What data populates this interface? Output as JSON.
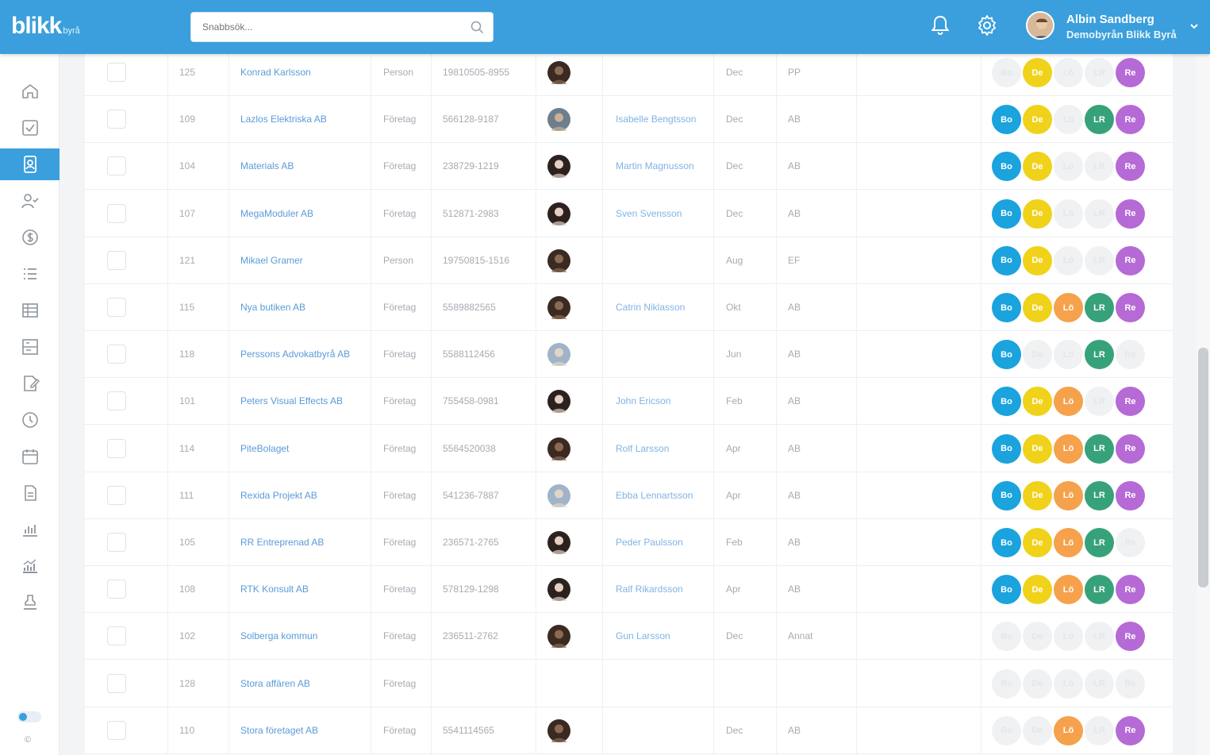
{
  "header": {
    "logo": "blikk",
    "logo_sub": "byrå",
    "search_placeholder": "Snabbsök...",
    "user_name": "Albin Sandberg",
    "user_org": "Demobyrån Blikk Byrå"
  },
  "sidebar": {
    "items": [
      {
        "icon": "home-icon"
      },
      {
        "icon": "checkbox-icon"
      },
      {
        "icon": "contacts-icon",
        "active": true
      },
      {
        "icon": "user-check-icon"
      },
      {
        "icon": "dollar-icon"
      },
      {
        "icon": "list-icon"
      },
      {
        "icon": "table-icon"
      },
      {
        "icon": "board-icon"
      },
      {
        "icon": "document-edit-icon"
      },
      {
        "icon": "clock-icon"
      },
      {
        "icon": "calendar-icon"
      },
      {
        "icon": "file-icon"
      },
      {
        "icon": "bar-chart-icon"
      },
      {
        "icon": "analytics-icon"
      },
      {
        "icon": "stamp-icon"
      }
    ],
    "copyright": "©"
  },
  "colors": {
    "Bo": "#1aa3dd",
    "De": "#f0d21b",
    "Lö": "#f6a14b",
    "LR": "#37a279",
    "Re": "#b56ad6"
  },
  "badge_labels": [
    "Bo",
    "De",
    "Lö",
    "LR",
    "Re"
  ],
  "rows": [
    {
      "id": "125",
      "name": "Konrad Karlsson",
      "type": "Person",
      "org": "19810505-8955",
      "avatar": "dark",
      "contact": "",
      "month": "Dec",
      "form": "PP",
      "badges": [
        0,
        1,
        0,
        0,
        1
      ]
    },
    {
      "id": "109",
      "name": "Lazlos Elektriska AB",
      "type": "Företag",
      "org": "566128-9187",
      "avatar": "mixed",
      "contact": "Isabelle Bengtsson",
      "month": "Dec",
      "form": "AB",
      "badges": [
        1,
        1,
        0,
        1,
        1
      ]
    },
    {
      "id": "104",
      "name": "Materials AB",
      "type": "Företag",
      "org": "238729-1219",
      "avatar": "woman",
      "contact": "Martin Magnusson",
      "month": "Dec",
      "form": "AB",
      "badges": [
        1,
        1,
        0,
        0,
        1
      ]
    },
    {
      "id": "107",
      "name": "MegaModuler AB",
      "type": "Företag",
      "org": "512871-2983",
      "avatar": "woman",
      "contact": "Sven Svensson",
      "month": "Dec",
      "form": "AB",
      "badges": [
        1,
        1,
        0,
        0,
        1
      ]
    },
    {
      "id": "121",
      "name": "Mikael Gramer",
      "type": "Person",
      "org": "19750815-1516",
      "avatar": "dark",
      "contact": "",
      "month": "Aug",
      "form": "EF",
      "badges": [
        1,
        1,
        0,
        0,
        1
      ]
    },
    {
      "id": "115",
      "name": "Nya butiken AB",
      "type": "Företag",
      "org": "5589882565",
      "avatar": "dark",
      "contact": "Catrin Niklasson",
      "month": "Okt",
      "form": "AB",
      "badges": [
        1,
        1,
        1,
        1,
        1
      ]
    },
    {
      "id": "118",
      "name": "Perssons Advokatbyrå AB",
      "type": "Företag",
      "org": "5588112456",
      "avatar": "light",
      "contact": "",
      "month": "Jun",
      "form": "AB",
      "badges": [
        1,
        0,
        0,
        1,
        0
      ]
    },
    {
      "id": "101",
      "name": "Peters Visual Effects AB",
      "type": "Företag",
      "org": "755458-0981",
      "avatar": "woman",
      "contact": "John Ericson",
      "month": "Feb",
      "form": "AB",
      "badges": [
        1,
        1,
        1,
        0,
        1
      ]
    },
    {
      "id": "114",
      "name": "PiteBolaget",
      "type": "Företag",
      "org": "5564520038",
      "avatar": "dark",
      "contact": "Rolf Larsson",
      "month": "Apr",
      "form": "AB",
      "badges": [
        1,
        1,
        1,
        1,
        1
      ]
    },
    {
      "id": "111",
      "name": "Rexida Projekt AB",
      "type": "Företag",
      "org": "541236-7887",
      "avatar": "light",
      "contact": "Ebba Lennartsson",
      "month": "Apr",
      "form": "AB",
      "badges": [
        1,
        1,
        1,
        1,
        1
      ]
    },
    {
      "id": "105",
      "name": "RR Entreprenad AB",
      "type": "Företag",
      "org": "236571-2765",
      "avatar": "woman",
      "contact": "Peder Paulsson",
      "month": "Feb",
      "form": "AB",
      "badges": [
        1,
        1,
        1,
        1,
        0
      ]
    },
    {
      "id": "108",
      "name": "RTK Konsult AB",
      "type": "Företag",
      "org": "578129-1298",
      "avatar": "woman",
      "contact": "Ralf Rikardsson",
      "month": "Apr",
      "form": "AB",
      "badges": [
        1,
        1,
        1,
        1,
        1
      ]
    },
    {
      "id": "102",
      "name": "Solberga kommun",
      "type": "Företag",
      "org": "236511-2762",
      "avatar": "dark",
      "contact": "Gun Larsson",
      "month": "Dec",
      "form": "Annat",
      "badges": [
        0,
        0,
        0,
        0,
        1
      ]
    },
    {
      "id": "128",
      "name": "Stora affären AB",
      "type": "Företag",
      "org": "",
      "avatar": "",
      "contact": "",
      "month": "",
      "form": "",
      "badges": [
        0,
        0,
        0,
        0,
        0
      ]
    },
    {
      "id": "110",
      "name": "Stora företaget AB",
      "type": "Företag",
      "org": "5541114565",
      "avatar": "dark",
      "contact": "",
      "month": "Dec",
      "form": "AB",
      "badges": [
        0,
        0,
        1,
        0,
        1
      ]
    }
  ]
}
